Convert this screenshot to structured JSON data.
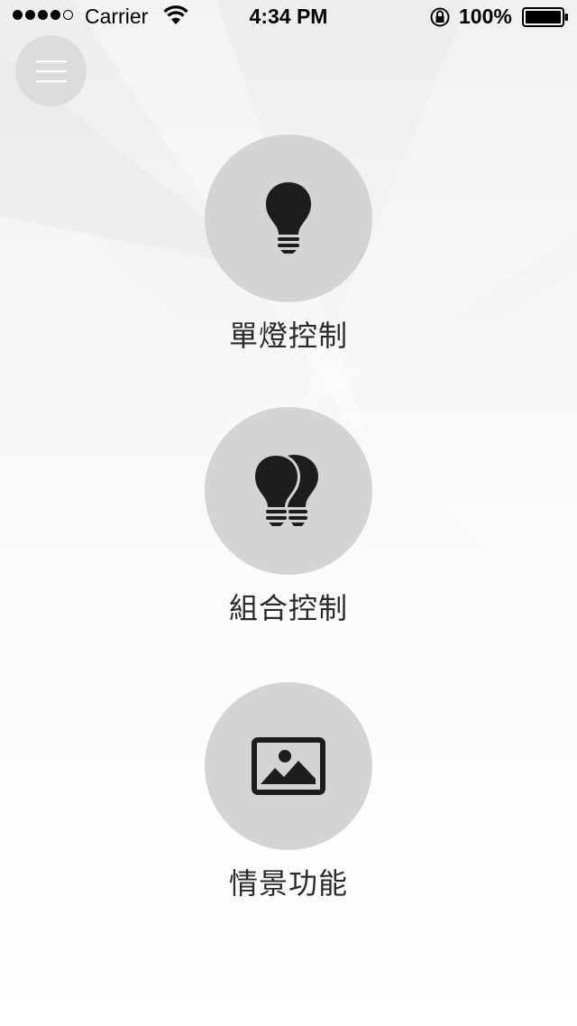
{
  "status_bar": {
    "carrier": "Carrier",
    "time": "4:34 PM",
    "battery": "100%",
    "signal_filled": 4,
    "signal_total": 5
  },
  "menu": {
    "icon": "hamburger-menu-icon"
  },
  "features": [
    {
      "label": "單燈控制",
      "icon": "single-bulb-icon"
    },
    {
      "label": "組合控制",
      "icon": "double-bulb-icon"
    },
    {
      "label": "情景功能",
      "icon": "picture-icon"
    }
  ],
  "colors": {
    "circle": "#d3d4d6",
    "menu_button": "#dcdcdc",
    "icon": "#1f1c1d",
    "label": "#2a2a2a"
  }
}
